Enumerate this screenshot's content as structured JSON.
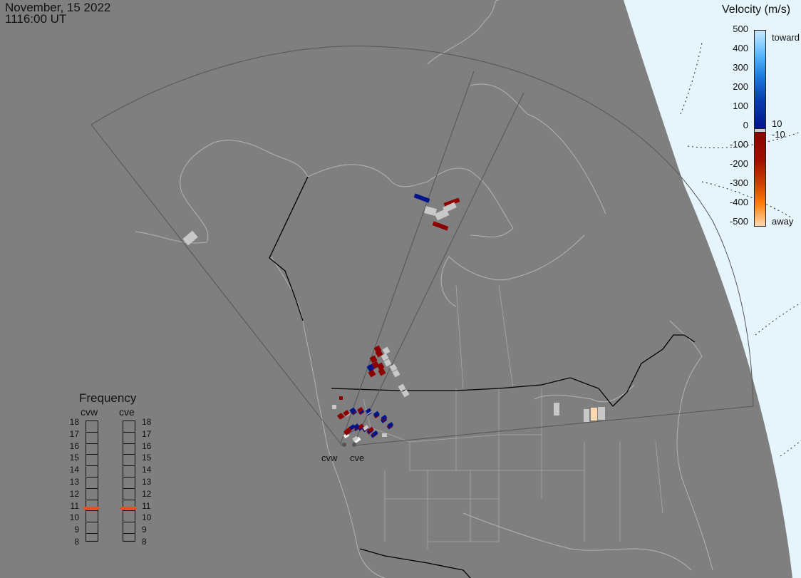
{
  "header": {
    "date": "November, 15 2022",
    "time": "1116:00 UT"
  },
  "velocity_legend": {
    "title": "Velocity (m/s)",
    "ticks": [
      "500",
      "400",
      "300",
      "200",
      "100",
      "0",
      "-100",
      "-200",
      "-300",
      "-400",
      "-500"
    ],
    "label_toward": "toward",
    "label_away": "away",
    "label_pos_threshold": "10",
    "label_neg_threshold": "-10",
    "colors": {
      "toward_max": "#c8e8ff",
      "toward_mid": "#1e7fe0",
      "toward_min": "#00148c",
      "ground_scatter": "#c8c8c8",
      "away_min": "#8c0000",
      "away_mid": "#ff7a00",
      "away_max": "#ffd8b0"
    }
  },
  "frequency_legend": {
    "title": "Frequency",
    "radars": [
      "cvw",
      "cve"
    ],
    "scale": [
      "18",
      "17",
      "16",
      "15",
      "14",
      "13",
      "12",
      "11",
      "10",
      "9",
      "8"
    ],
    "cvw_mhz": 10.8,
    "cve_mhz": 10.8
  },
  "radar_sites": {
    "west": "cvw",
    "east": "cve"
  },
  "colors": {
    "background_land": "#7f7f7f",
    "daylight": "#e6f5fc",
    "coast": "#b4b4b4",
    "border": "#000000",
    "fov": "#555555"
  }
}
